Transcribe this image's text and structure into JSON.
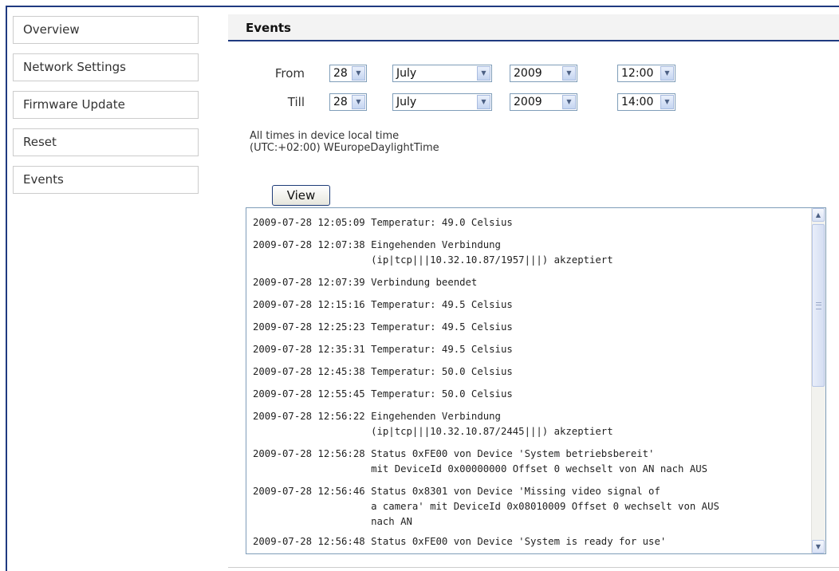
{
  "nav": {
    "items": [
      {
        "label": "Overview"
      },
      {
        "label": "Network Settings"
      },
      {
        "label": "Firmware Update"
      },
      {
        "label": "Reset"
      },
      {
        "label": "Events"
      }
    ]
  },
  "section": {
    "title": "Events"
  },
  "filter": {
    "from_label": "From",
    "till_label": "Till",
    "from": {
      "day": "28",
      "month": "July",
      "year": "2009",
      "time": "12:00"
    },
    "till": {
      "day": "28",
      "month": "July",
      "year": "2009",
      "time": "14:00"
    }
  },
  "note": {
    "line1": "All times in device local time",
    "line2": "(UTC:+02:00) WEuropeDaylightTime"
  },
  "view_button": "View",
  "log": {
    "entries": [
      {
        "ts": "2009-07-28 12:05:09 ",
        "msg": "Temperatur: 49.0 Celsius"
      },
      {
        "ts": "2009-07-28 12:07:38 ",
        "msg": "Eingehenden Verbindung\n(ip|tcp|||10.32.10.87/1957|||) akzeptiert"
      },
      {
        "ts": "2009-07-28 12:07:39 ",
        "msg": "Verbindung beendet"
      },
      {
        "ts": "2009-07-28 12:15:16 ",
        "msg": "Temperatur: 49.5 Celsius"
      },
      {
        "ts": "2009-07-28 12:25:23 ",
        "msg": "Temperatur: 49.5 Celsius"
      },
      {
        "ts": "2009-07-28 12:35:31 ",
        "msg": "Temperatur: 49.5 Celsius"
      },
      {
        "ts": "2009-07-28 12:45:38 ",
        "msg": "Temperatur: 50.0 Celsius"
      },
      {
        "ts": "2009-07-28 12:55:45 ",
        "msg": "Temperatur: 50.0 Celsius"
      },
      {
        "ts": "2009-07-28 12:56:22 ",
        "msg": "Eingehenden Verbindung\n(ip|tcp|||10.32.10.87/2445|||) akzeptiert"
      },
      {
        "ts": "2009-07-28 12:56:28 ",
        "msg": "Status 0xFE00 von Device 'System betriebsbereit'\nmit DeviceId 0x00000000 Offset 0 wechselt von AN nach AUS"
      },
      {
        "ts": "2009-07-28 12:56:46 ",
        "msg": "Status 0x8301 von Device 'Missing video signal of\na camera' mit DeviceId 0x08010009 Offset 0 wechselt von AUS\nnach AN"
      },
      {
        "ts": "2009-07-28 12:56:48 ",
        "msg": "Status 0xFE00 von Device 'System is ready for use'"
      }
    ]
  },
  "icons": {
    "dropdown": "chevron-down-icon",
    "scroll_up": "arrow-up-icon",
    "scroll_down": "arrow-down-icon"
  },
  "colors": {
    "accent": "#1f3a80",
    "border": "#cccccc",
    "select_border": "#7f9db9"
  }
}
